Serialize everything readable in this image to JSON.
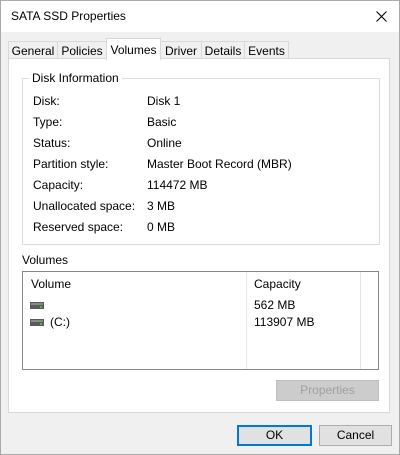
{
  "window": {
    "title": "SATA SSD Properties"
  },
  "tabs": [
    {
      "label": "General"
    },
    {
      "label": "Policies"
    },
    {
      "label": "Volumes"
    },
    {
      "label": "Driver"
    },
    {
      "label": "Details"
    },
    {
      "label": "Events"
    }
  ],
  "active_tab": "Volumes",
  "disk_info": {
    "group_title": "Disk Information",
    "rows": [
      {
        "label": "Disk:",
        "value": "Disk 1"
      },
      {
        "label": "Type:",
        "value": "Basic"
      },
      {
        "label": "Status:",
        "value": "Online"
      },
      {
        "label": "Partition style:",
        "value": "Master Boot Record (MBR)"
      },
      {
        "label": "Capacity:",
        "value": "114472 MB"
      },
      {
        "label": "Unallocated space:",
        "value": "3 MB"
      },
      {
        "label": "Reserved space:",
        "value": "0 MB"
      }
    ]
  },
  "volumes": {
    "title": "Volumes",
    "columns": {
      "volume": "Volume",
      "capacity": "Capacity"
    },
    "rows": [
      {
        "volume": "",
        "capacity": "562 MB",
        "icon": "drive-icon"
      },
      {
        "volume": "(C:)",
        "capacity": "113907 MB",
        "icon": "drive-icon"
      }
    ]
  },
  "buttons": {
    "properties": "Properties",
    "ok": "OK",
    "cancel": "Cancel"
  }
}
